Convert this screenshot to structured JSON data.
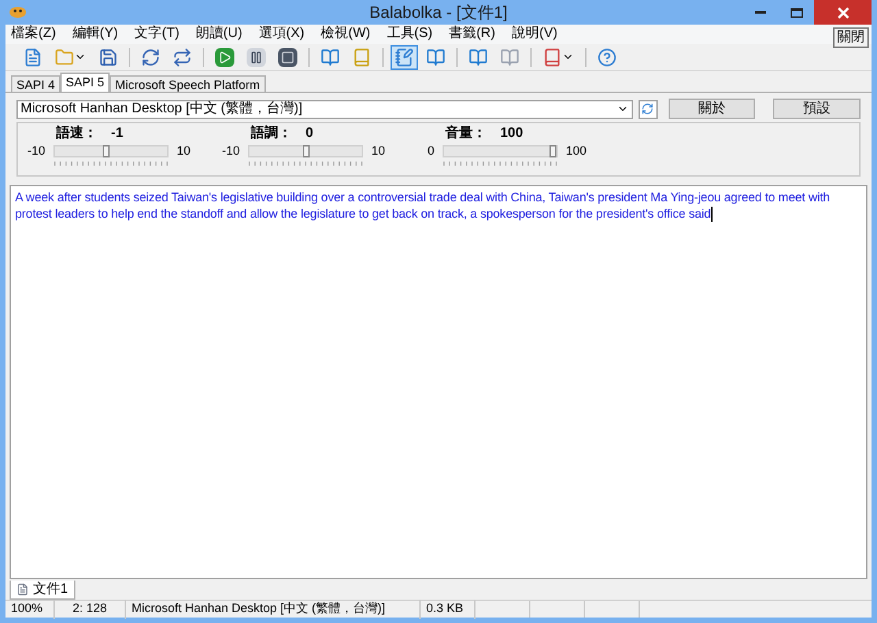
{
  "window": {
    "title": "Balabolka - [文件1]",
    "tooltip": "關閉"
  },
  "menu": [
    "檔案(Z)",
    "編輯(Y)",
    "文字(T)",
    "朗讀(U)",
    "選項(X)",
    "檢視(W)",
    "工具(S)",
    "書籤(R)",
    "說明(V)"
  ],
  "toolbar": [
    {
      "kind": "new",
      "selected": false
    },
    {
      "kind": "open",
      "selected": false
    },
    {
      "kind": "save",
      "selected": false
    },
    {
      "kind": "sep"
    },
    {
      "kind": "convert",
      "selected": false
    },
    {
      "kind": "convert2",
      "selected": false
    },
    {
      "kind": "sep"
    },
    {
      "kind": "play",
      "selected": false
    },
    {
      "kind": "pause",
      "selected": false
    },
    {
      "kind": "stop",
      "selected": false
    },
    {
      "kind": "sep"
    },
    {
      "kind": "book",
      "selected": false
    },
    {
      "kind": "book2",
      "selected": false
    },
    {
      "kind": "sep"
    },
    {
      "kind": "note",
      "selected": true
    },
    {
      "kind": "book",
      "selected": false
    },
    {
      "kind": "sep"
    },
    {
      "kind": "book",
      "selected": false
    },
    {
      "kind": "book3",
      "selected": false
    },
    {
      "kind": "sep"
    },
    {
      "kind": "dropbook",
      "selected": false
    },
    {
      "kind": "sep"
    },
    {
      "kind": "help",
      "selected": false
    }
  ],
  "engine_tabs": [
    {
      "label": "SAPI 4",
      "selected": false
    },
    {
      "label": "SAPI 5",
      "selected": true
    },
    {
      "label": "Microsoft Speech Platform",
      "selected": false
    }
  ],
  "voice": {
    "value": "Microsoft Hanhan Desktop [中文 (繁體，台灣)]",
    "buttons": [
      "關於",
      "預設"
    ]
  },
  "sliders": [
    {
      "label": "語速：",
      "reading": "-1",
      "min": "-10",
      "max": "10",
      "level": 0.45
    },
    {
      "label": "語調：",
      "reading": "0",
      "min": "-10",
      "max": "10",
      "level": 0.5
    },
    {
      "label": "音量：",
      "reading": "100",
      "min": "0",
      "max": "100",
      "level": 1
    }
  ],
  "text": "A week after students seized Taiwan's legislative building over a controversial trade deal with China, Taiwan's president Ma Ying-jeou agreed to meet with protest leaders to help end the standoff and allow the legislature to get back on track, a spokesperson for the president's office said",
  "doc_tabs": [
    {
      "label": "文件1",
      "selected": true
    }
  ],
  "status_bar": [
    "100%",
    "2: 128",
    "Microsoft Hanhan Desktop [中文 (繁體，台灣)]",
    "0.3 KB"
  ]
}
